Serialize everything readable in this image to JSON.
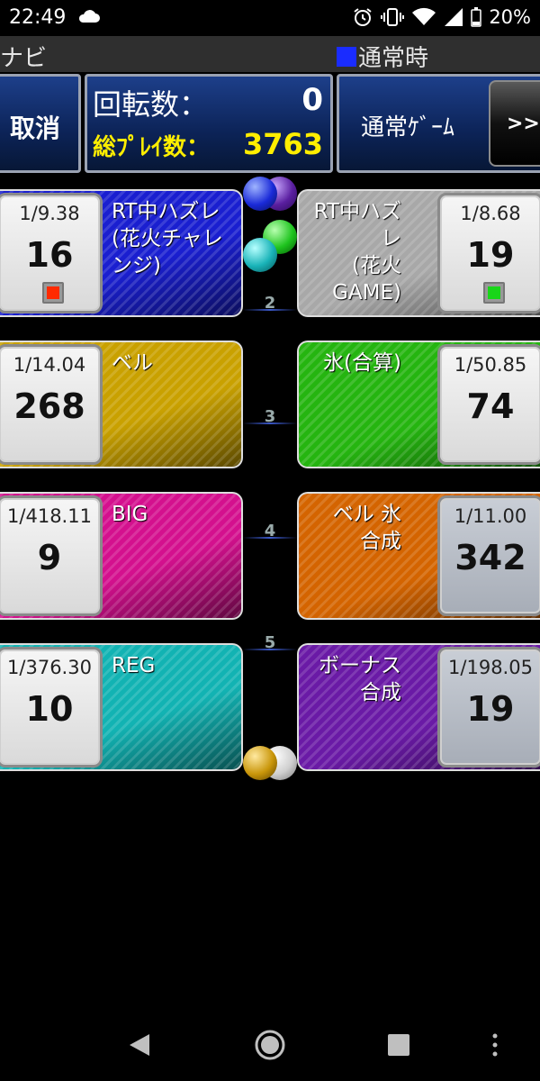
{
  "status_bar": {
    "time": "22:49",
    "battery": "20%",
    "icons": [
      "cloud-icon",
      "alarm-icon",
      "vibrate-icon",
      "wifi-icon",
      "signal-icon",
      "battery-icon"
    ]
  },
  "app": {
    "title": "ハナビ",
    "mode_label": "通常時",
    "mode_color": "#1a2cff"
  },
  "controls": {
    "cancel": "取消",
    "spin_label": "回転数：",
    "spin_value": "0",
    "total_label": "総ﾌﾟﾚｲ数：",
    "total_value": "3763",
    "normal_game": "通常ｹﾞｰﾑ",
    "forward": ">>"
  },
  "rows": [
    {
      "lane": "",
      "left": {
        "name": "RT中ハズレ\n(花火チャレ\nンジ)",
        "prob": "1/9.38",
        "count": "16",
        "color": "#1a1fd0",
        "lamp": "#ff2a00"
      },
      "right": {
        "name": "RT中ハズレ\n(花火\nGAME)",
        "prob": "1/8.68",
        "count": "19",
        "color": "#a8a8a8",
        "lamp": "#19d619"
      }
    },
    {
      "lane": "2",
      "left": {
        "name": "ベル",
        "prob": "1/14.04",
        "count": "268",
        "color": "#c9a100"
      },
      "right": {
        "name": "氷(合算)",
        "prob": "1/50.85",
        "count": "74",
        "color": "#25b510"
      }
    },
    {
      "lane": "3",
      "left": {
        "name": "BIG",
        "prob": "1/418.11",
        "count": "9",
        "color": "#d4108e"
      },
      "right": {
        "name": "ベル 氷\n合成",
        "prob": "1/11.00",
        "count": "342",
        "color": "#d46400"
      }
    },
    {
      "lane": "4",
      "left": {
        "name": "REG",
        "prob": "1/376.30",
        "count": "10",
        "color": "#12b3b3"
      },
      "right": {
        "name": "ボーナス\n合成",
        "prob": "1/198.05",
        "count": "19",
        "color": "#6a1aa6"
      }
    }
  ],
  "lane_numbers": [
    "2",
    "3",
    "4",
    "5"
  ],
  "navbar": {
    "icons": [
      "back-icon",
      "home-icon",
      "recents-icon",
      "menu-icon"
    ]
  }
}
